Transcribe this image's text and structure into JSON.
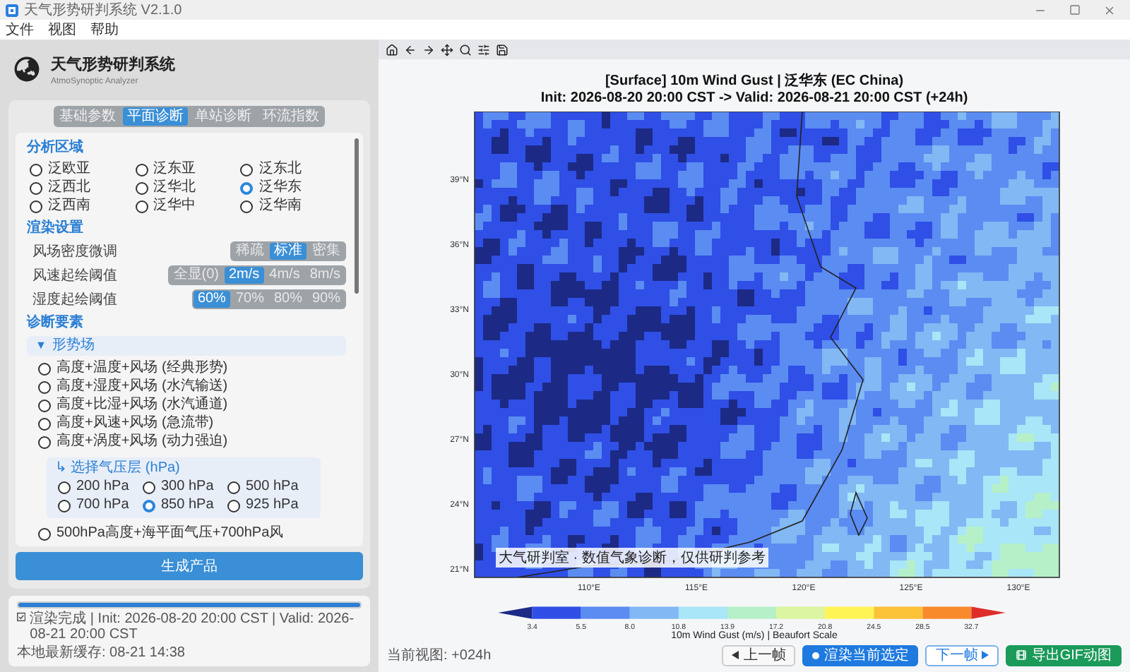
{
  "window": {
    "title": "天气形势研判系统 V2.1.0"
  },
  "menu": [
    "文件",
    "视图",
    "帮助"
  ],
  "app": {
    "title": "天气形势研判系统",
    "subtitle": "AtmoSynoptic Analyzer"
  },
  "tabs": [
    {
      "label": "基础参数",
      "selected": false
    },
    {
      "label": "平面诊断",
      "selected": true
    },
    {
      "label": "单站诊断",
      "selected": false
    },
    {
      "label": "环流指数",
      "selected": false
    }
  ],
  "region": {
    "title": "分析区域",
    "options": [
      {
        "label": "泛欧亚",
        "selected": false
      },
      {
        "label": "泛东亚",
        "selected": false
      },
      {
        "label": "泛东北",
        "selected": false
      },
      {
        "label": "泛西北",
        "selected": false
      },
      {
        "label": "泛华北",
        "selected": false
      },
      {
        "label": "泛华东",
        "selected": true
      },
      {
        "label": "泛西南",
        "selected": false
      },
      {
        "label": "泛华中",
        "selected": false
      },
      {
        "label": "泛华南",
        "selected": false
      }
    ]
  },
  "render": {
    "title": "渲染设置",
    "rows": [
      {
        "label": "风场密度微调",
        "options": [
          {
            "label": "稀疏",
            "selected": false
          },
          {
            "label": "标准",
            "selected": true
          },
          {
            "label": "密集",
            "selected": false
          }
        ]
      },
      {
        "label": "风速起绘阈值",
        "options": [
          {
            "label": "全显(0)",
            "selected": false
          },
          {
            "label": "2m/s",
            "selected": true
          },
          {
            "label": "4m/s",
            "selected": false
          },
          {
            "label": "8m/s",
            "selected": false
          }
        ]
      },
      {
        "label": "湿度起绘阈值",
        "options": [
          {
            "label": "60%",
            "selected": true
          },
          {
            "label": "70%",
            "selected": false
          },
          {
            "label": "80%",
            "selected": false
          },
          {
            "label": "90%",
            "selected": false
          }
        ]
      }
    ]
  },
  "diagnosis": {
    "title": "诊断要素",
    "group": {
      "arrow": "▼",
      "label": "形势场",
      "expanded": true
    },
    "elements": [
      {
        "label": "高度+温度+风场 (经典形势)",
        "selected": false
      },
      {
        "label": "高度+湿度+风场 (水汽输送)",
        "selected": false
      },
      {
        "label": "高度+比湿+风场 (水汽通道)",
        "selected": false
      },
      {
        "label": "高度+风速+风场 (急流带)",
        "selected": false
      },
      {
        "label": "高度+涡度+风场 (动力强迫)",
        "selected": false
      }
    ],
    "levels": {
      "title": "↳ 选择气压层 (hPa)",
      "options": [
        {
          "label": "200 hPa",
          "selected": false
        },
        {
          "label": "300 hPa",
          "selected": false
        },
        {
          "label": "500 hPa",
          "selected": false
        },
        {
          "label": "700 hPa",
          "selected": false
        },
        {
          "label": "850 hPa",
          "selected": true
        },
        {
          "label": "925 hPa",
          "selected": false
        }
      ]
    },
    "extra": {
      "label": "500hPa高度+海平面气压+700hPa风",
      "selected": false
    }
  },
  "generate_button": "生成产品",
  "status": {
    "level": 1,
    "text": "渲染完成 | Init: 2026-08-20 20:00 CST | Valid: 2026-08-21 20:00 CST",
    "cache": "本地最新缓存: 08-21 14:38"
  },
  "plot": {
    "title": "[Surface] 10m Wind Gust | 泛华东 (EC China)",
    "subtitle": "Init: 2026-08-20 20:00 CST -> Valid: 2026-08-21 20:00 CST (+24h)",
    "lat_ticks": [
      "39°N",
      "36°N",
      "33°N",
      "30°N",
      "27°N",
      "24°N",
      "21°N"
    ],
    "lon_ticks": [
      "110°E",
      "115°E",
      "120°E",
      "125°E",
      "130°E"
    ],
    "credit": "大气研判室 · 数值气象诊断，仅供研判参考"
  },
  "colorbar": {
    "segments": [
      {
        "kind": "low",
        "color": "#1c2a86"
      },
      {
        "kind": "band",
        "color": "#2f4fe6"
      },
      {
        "kind": "band",
        "color": "#5b8cf2"
      },
      {
        "kind": "band",
        "color": "#82b8f3"
      },
      {
        "kind": "band",
        "color": "#a8e6f8"
      },
      {
        "kind": "band",
        "color": "#b6f0c8"
      },
      {
        "kind": "band",
        "color": "#dcf5a0"
      },
      {
        "kind": "band",
        "color": "#fff455"
      },
      {
        "kind": "band",
        "color": "#fcc237"
      },
      {
        "kind": "band",
        "color": "#f88a2c"
      },
      {
        "kind": "high",
        "color": "#dd2e2a"
      }
    ],
    "ticks": [
      "3.4",
      "5.5",
      "8.0",
      "10.8",
      "13.9",
      "17.2",
      "20.8",
      "24.5",
      "28.5",
      "32.7"
    ],
    "caption": "10m Wind Gust (m/s) | Beaufort Scale"
  },
  "view_label": "当前视图: +024h",
  "actions": [
    {
      "kind": "default",
      "label": "上一帧"
    },
    {
      "kind": "primary",
      "label": "渲染当前选定"
    },
    {
      "kind": "outline",
      "label": "下一帧"
    },
    {
      "kind": "success",
      "label": "导出GIF动图"
    }
  ]
}
